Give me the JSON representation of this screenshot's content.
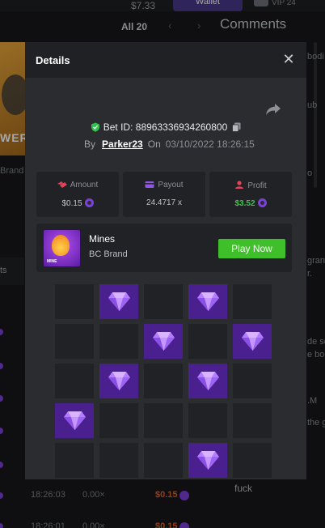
{
  "background": {
    "balance": "$7.33",
    "wallet_label": "Wallet",
    "vip_label": "VIP 24",
    "all_filter": "All 20",
    "comments_title": "Comments",
    "game_banner_text": "WER",
    "game_brand": "Brand",
    "side_tab": "ts",
    "rows": [
      {
        "time": "18:26:03",
        "mult": "0.00×",
        "payout": "$0.15"
      },
      {
        "time": "18:26:01",
        "mult": "0.00×",
        "payout": "$0.15"
      }
    ],
    "comment_snippets": [
      "bodi",
      "ub",
      "o",
      "gran",
      "r.",
      "de se",
      "e bo",
      ".M",
      "the g"
    ],
    "comment_last": "fuck"
  },
  "modal": {
    "title": "Details",
    "bet_id_label": "Bet ID:",
    "bet_id": "88963336934260800",
    "by_label": "By",
    "username": "Parker23",
    "on_label": "On",
    "date": "03/10/2022 18:26:15",
    "stats": {
      "amount_label": "Amount",
      "amount_value": "$0.15",
      "payout_label": "Payout",
      "payout_value": "24.4717 x",
      "profit_label": "Profit",
      "profit_value": "$3.52"
    },
    "game": {
      "name": "Mines",
      "brand": "BC Brand",
      "thumb_tag": "MINE",
      "play_label": "Play Now"
    },
    "grid": [
      [
        0,
        1,
        0,
        1,
        0
      ],
      [
        0,
        0,
        1,
        0,
        1
      ],
      [
        0,
        1,
        0,
        1,
        0
      ],
      [
        1,
        0,
        0,
        0,
        0
      ],
      [
        0,
        0,
        0,
        1,
        0
      ]
    ]
  },
  "colors": {
    "accent_green": "#3fbf2a",
    "gem_bg": "#4a1f8e",
    "coin": "#7b3fe0",
    "profit_green": "#3ec24a"
  }
}
